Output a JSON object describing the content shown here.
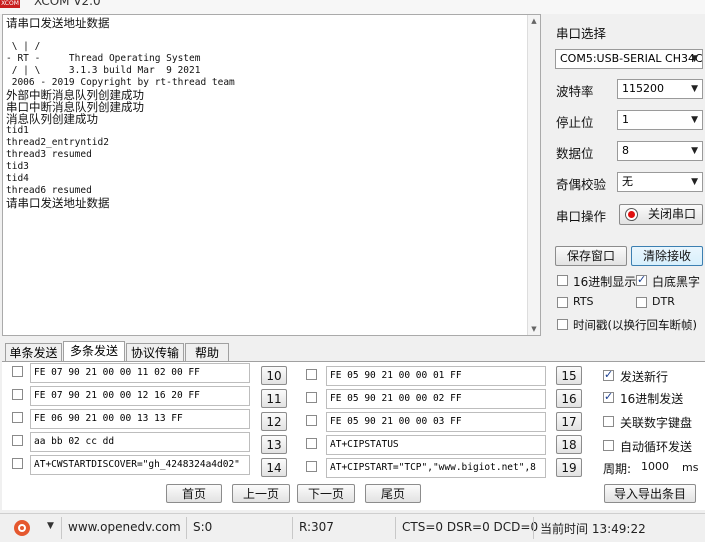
{
  "titlebar": {
    "logo": "XCOM",
    "title": "XCOM V2.0"
  },
  "receive": {
    "lines": [
      {
        "t": "请串口发送地址数据",
        "zh": true
      },
      {
        "t": "",
        "zh": false
      },
      {
        "t": " \\ | /",
        "zh": false
      },
      {
        "t": "- RT -     Thread Operating System",
        "zh": false
      },
      {
        "t": " / | \\     3.1.3 build Mar  9 2021",
        "zh": false
      },
      {
        "t": " 2006 - 2019 Copyright by rt-thread team",
        "zh": false
      },
      {
        "t": "外部中断消息队列创建成功",
        "zh": true
      },
      {
        "t": "串口中断消息队列创建成功",
        "zh": true
      },
      {
        "t": "消息队列创建成功",
        "zh": true
      },
      {
        "t": "tid1",
        "zh": false
      },
      {
        "t": "thread2_entryntid2",
        "zh": false
      },
      {
        "t": "thread3 resumed",
        "zh": false
      },
      {
        "t": "tid3",
        "zh": false
      },
      {
        "t": "tid4",
        "zh": false
      },
      {
        "t": "thread6 resumed",
        "zh": false
      },
      {
        "t": "请串口发送地址数据",
        "zh": true
      }
    ]
  },
  "serial": {
    "port_label": "串口选择",
    "port_value": "COM5:USB-SERIAL CH34C",
    "baud_label": "波特率",
    "baud_value": "115200",
    "stop_label": "停止位",
    "stop_value": "1",
    "data_label": "数据位",
    "data_value": "8",
    "parity_label": "奇偶校验",
    "parity_value": "无",
    "op_label": "串口操作",
    "op_button": "关闭串口",
    "status_color": "#e01010"
  },
  "actions": {
    "save": "保存窗口",
    "clear": "清除接收"
  },
  "options": {
    "hex_display": {
      "label": "16进制显示",
      "checked": false
    },
    "white_black": {
      "label": "白底黑字",
      "checked": true
    },
    "rts": {
      "label": "RTS",
      "checked": false
    },
    "dtr": {
      "label": "DTR",
      "checked": false
    },
    "timestamp": {
      "label": "时间戳(以换行回车断帧)",
      "checked": false
    }
  },
  "tabs": [
    "单条发送",
    "多条发送",
    "协议传输",
    "帮助"
  ],
  "multi": {
    "left": [
      {
        "checked": false,
        "value": "FE 07 90 21 00 00 11 02 00 FF",
        "num": "10"
      },
      {
        "checked": false,
        "value": "FE 07 90 21 00 00 12 16 20 FF",
        "num": "11"
      },
      {
        "checked": false,
        "value": "FE 06 90 21 00 00 13 13 FF",
        "num": "12"
      },
      {
        "checked": false,
        "value": "aa bb 02 cc dd",
        "num": "13"
      },
      {
        "checked": false,
        "value": "AT+CWSTARTDISCOVER=\"gh_4248324a4d02\"",
        "num": "14"
      }
    ],
    "right": [
      {
        "checked": false,
        "value": "FE 05 90 21 00 00 01 FF",
        "num": "15"
      },
      {
        "checked": false,
        "value": "FE 05 90 21 00 00 02 FF",
        "num": "16"
      },
      {
        "checked": false,
        "value": "FE 05 90 21 00 00 03 FF",
        "num": "17"
      },
      {
        "checked": false,
        "value": "AT+CIPSTATUS",
        "num": "18"
      },
      {
        "checked": false,
        "value": "AT+CIPSTART=\"TCP\",\"www.bigiot.net\",8",
        "num": "19"
      }
    ],
    "send_newline": {
      "label": "发送新行",
      "checked": true
    },
    "hex_send": {
      "label": "16进制发送",
      "checked": true
    },
    "numpad": {
      "label": "关联数字键盘",
      "checked": false
    },
    "auto_loop": {
      "label": "自动循环发送",
      "checked": false
    },
    "period_label": "周期:",
    "period_value": "1000",
    "period_unit": "ms",
    "first_page": "首页",
    "prev_page": "上一页",
    "next_page": "下一页",
    "last_page": "尾页",
    "import_export": "导入导出条目"
  },
  "statusbar": {
    "website": "www.openedv.com",
    "sent": "S:0",
    "received": "R:307",
    "lines": "CTS=0 DSR=0 DCD=0",
    "time": "当前时间 13:49:22"
  }
}
